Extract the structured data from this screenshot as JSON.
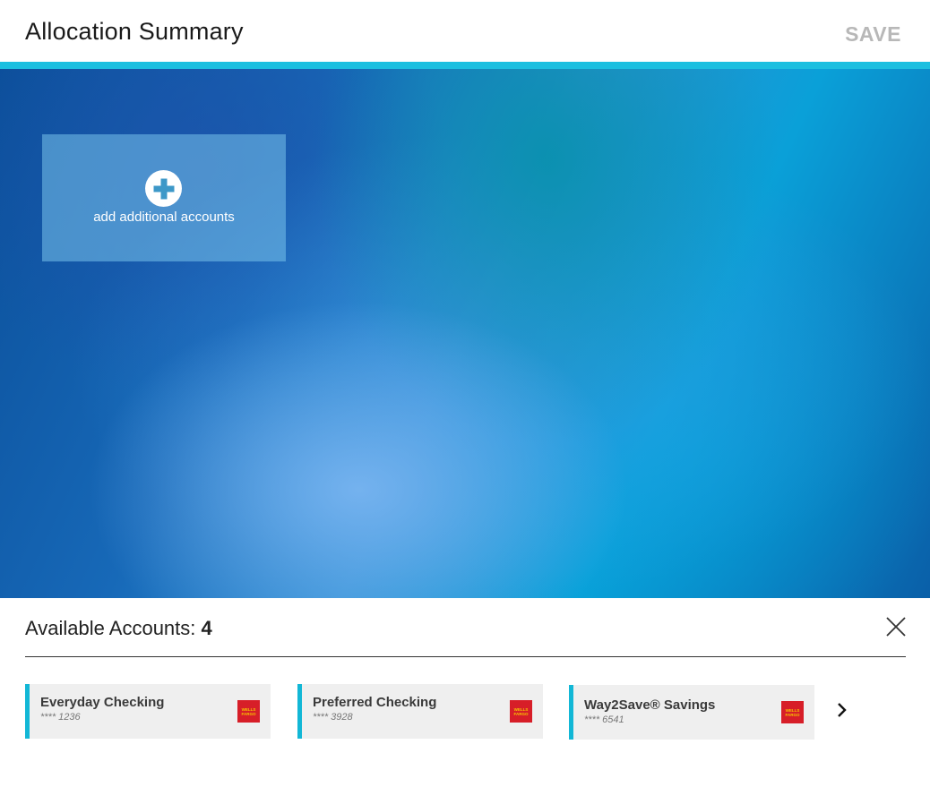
{
  "header": {
    "title": "Allocation Summary",
    "save_label": "SAVE"
  },
  "colors": {
    "accent": "#1bbfe0",
    "save_disabled": "#b8b8b8",
    "bank_logo": "#d71e28"
  },
  "canvas": {
    "add_card": {
      "icon": "plus-circle-icon",
      "label": "add additional accounts"
    }
  },
  "available": {
    "label": "Available Accounts: ",
    "count": "4",
    "close_icon": "close-icon",
    "next_icon": "chevron-right-icon",
    "accounts": [
      {
        "name": "Everyday Checking",
        "number": "**** 1236",
        "logo_text": "WELLS FARGO"
      },
      {
        "name": "Preferred Checking",
        "number": "**** 3928",
        "logo_text": "WELLS FARGO"
      },
      {
        "name": "Way2Save® Savings",
        "number": "**** 6541",
        "logo_text": "WELLS FARGO"
      }
    ]
  }
}
